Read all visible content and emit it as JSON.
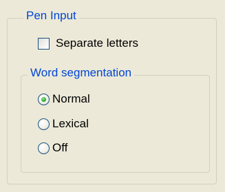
{
  "pen_input": {
    "title": "Pen Input",
    "separate_letters": {
      "label": "Separate letters",
      "checked": false
    }
  },
  "word_segmentation": {
    "title": "Word segmentation",
    "options": [
      {
        "label": "Normal",
        "selected": true
      },
      {
        "label": "Lexical",
        "selected": false
      },
      {
        "label": "Off",
        "selected": false
      }
    ]
  },
  "colors": {
    "group_title": "#0046d5",
    "background": "#ece9d8",
    "group_border": "#d0d0bf",
    "control_border": "#1c5180",
    "radio_dot": "#21a121"
  }
}
